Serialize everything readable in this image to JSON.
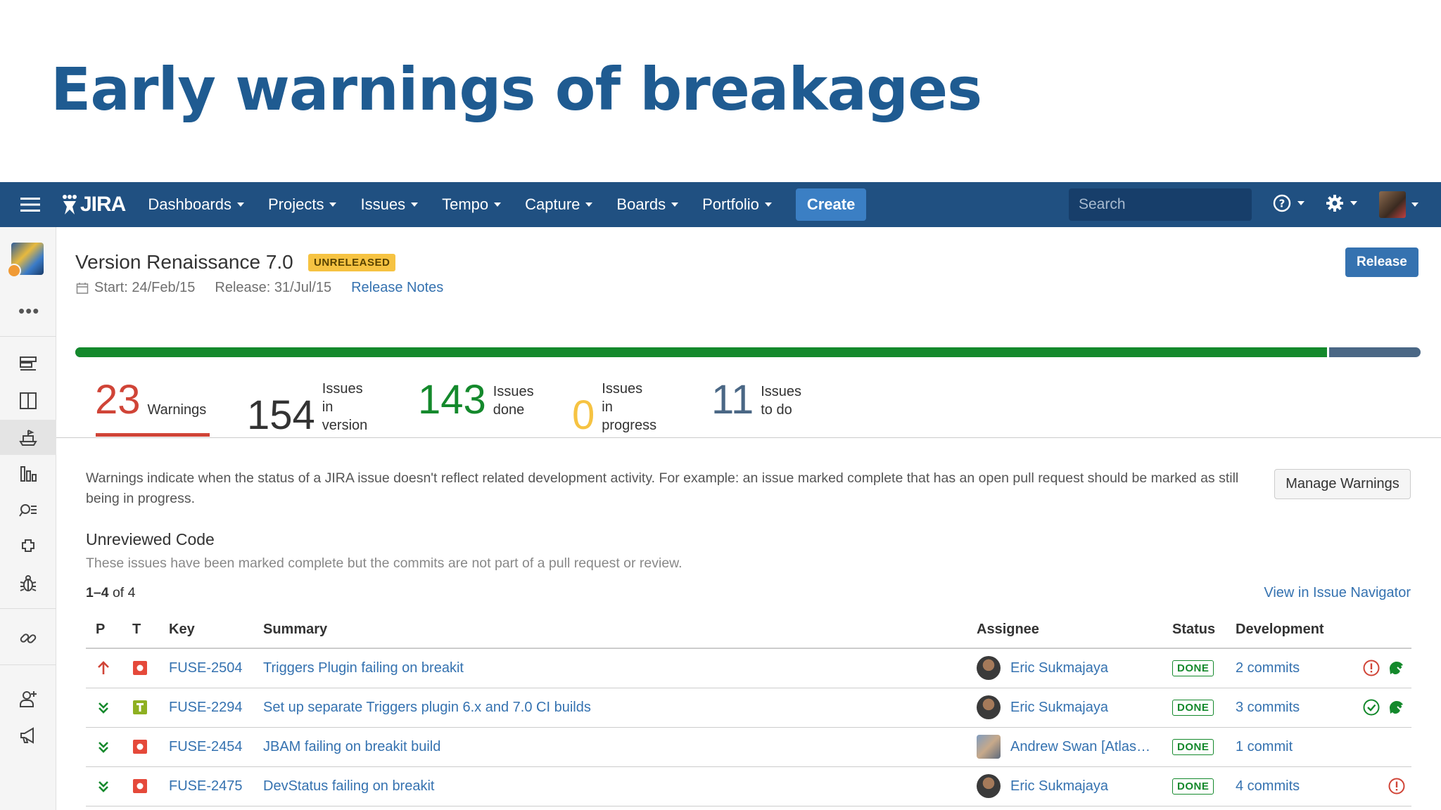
{
  "slide": {
    "title": "Early warnings of breakages"
  },
  "nav": {
    "logo": "JIRA",
    "items": [
      "Dashboards",
      "Projects",
      "Issues",
      "Tempo",
      "Capture",
      "Boards",
      "Portfolio"
    ],
    "create_label": "Create",
    "search_placeholder": "Search"
  },
  "version": {
    "title": "Version Renaissance 7.0",
    "badge": "UNRELEASED",
    "start": "Start: 24/Feb/15",
    "release": "Release: 31/Jul/15",
    "release_notes": "Release Notes",
    "release_button": "Release",
    "progress_done_fraction": 0.931
  },
  "stats": {
    "warnings": {
      "num": "23",
      "label": "Warnings"
    },
    "in_version": {
      "num": "154",
      "label1": "Issues in",
      "label2": "version"
    },
    "done": {
      "num": "143",
      "label1": "Issues",
      "label2": "done"
    },
    "in_progress": {
      "num": "0",
      "label1": "Issues",
      "label2": "in progress"
    },
    "to_do": {
      "num": "11",
      "label1": "Issues",
      "label2": "to do"
    }
  },
  "colors": {
    "warning": "#d04437",
    "done": "#14892c",
    "in_progress": "#f6c342",
    "todo": "#4a6785",
    "link": "#3572b0"
  },
  "warnings_panel": {
    "description": "Warnings indicate when the status of a JIRA issue doesn't reflect related development activity. For example: an issue marked complete that has an open pull request should be marked as still being in progress.",
    "manage_button": "Manage Warnings",
    "section_title": "Unreviewed Code",
    "section_subtitle": "These issues have been marked complete but the commits are not part of a pull request or review.",
    "count_range": "1–4",
    "count_suffix": " of 4",
    "view_link": "View in Issue Navigator"
  },
  "table": {
    "headers": [
      "P",
      "T",
      "Key",
      "Summary",
      "Assignee",
      "Status",
      "Development"
    ],
    "rows": [
      {
        "priority": "highest-priority-icon",
        "type": "bug-icon",
        "key": "FUSE-2504",
        "summary": "Triggers Plugin failing on breakit",
        "assignee": "Eric Sukmajaya",
        "status": "DONE",
        "dev": "2 commits",
        "warn": true,
        "build": true,
        "ok": false
      },
      {
        "priority": "low-priority-icon",
        "type": "task-icon",
        "key": "FUSE-2294",
        "summary": "Set up separate Triggers plugin 6.x and 7.0 CI builds",
        "assignee": "Eric Sukmajaya",
        "status": "DONE",
        "dev": "3 commits",
        "warn": false,
        "build": true,
        "ok": true
      },
      {
        "priority": "low-priority-icon",
        "type": "bug-icon",
        "key": "FUSE-2454",
        "summary": "JBAM failing on breakit build",
        "assignee": "Andrew Swan [Atlas…",
        "status": "DONE",
        "dev": "1 commit",
        "warn": false,
        "build": false,
        "ok": false
      },
      {
        "priority": "low-priority-icon",
        "type": "bug-icon",
        "key": "FUSE-2475",
        "summary": "DevStatus failing on breakit",
        "assignee": "Eric Sukmajaya",
        "status": "DONE",
        "dev": "4 commits",
        "warn": true,
        "build": false,
        "ok": false
      }
    ]
  }
}
